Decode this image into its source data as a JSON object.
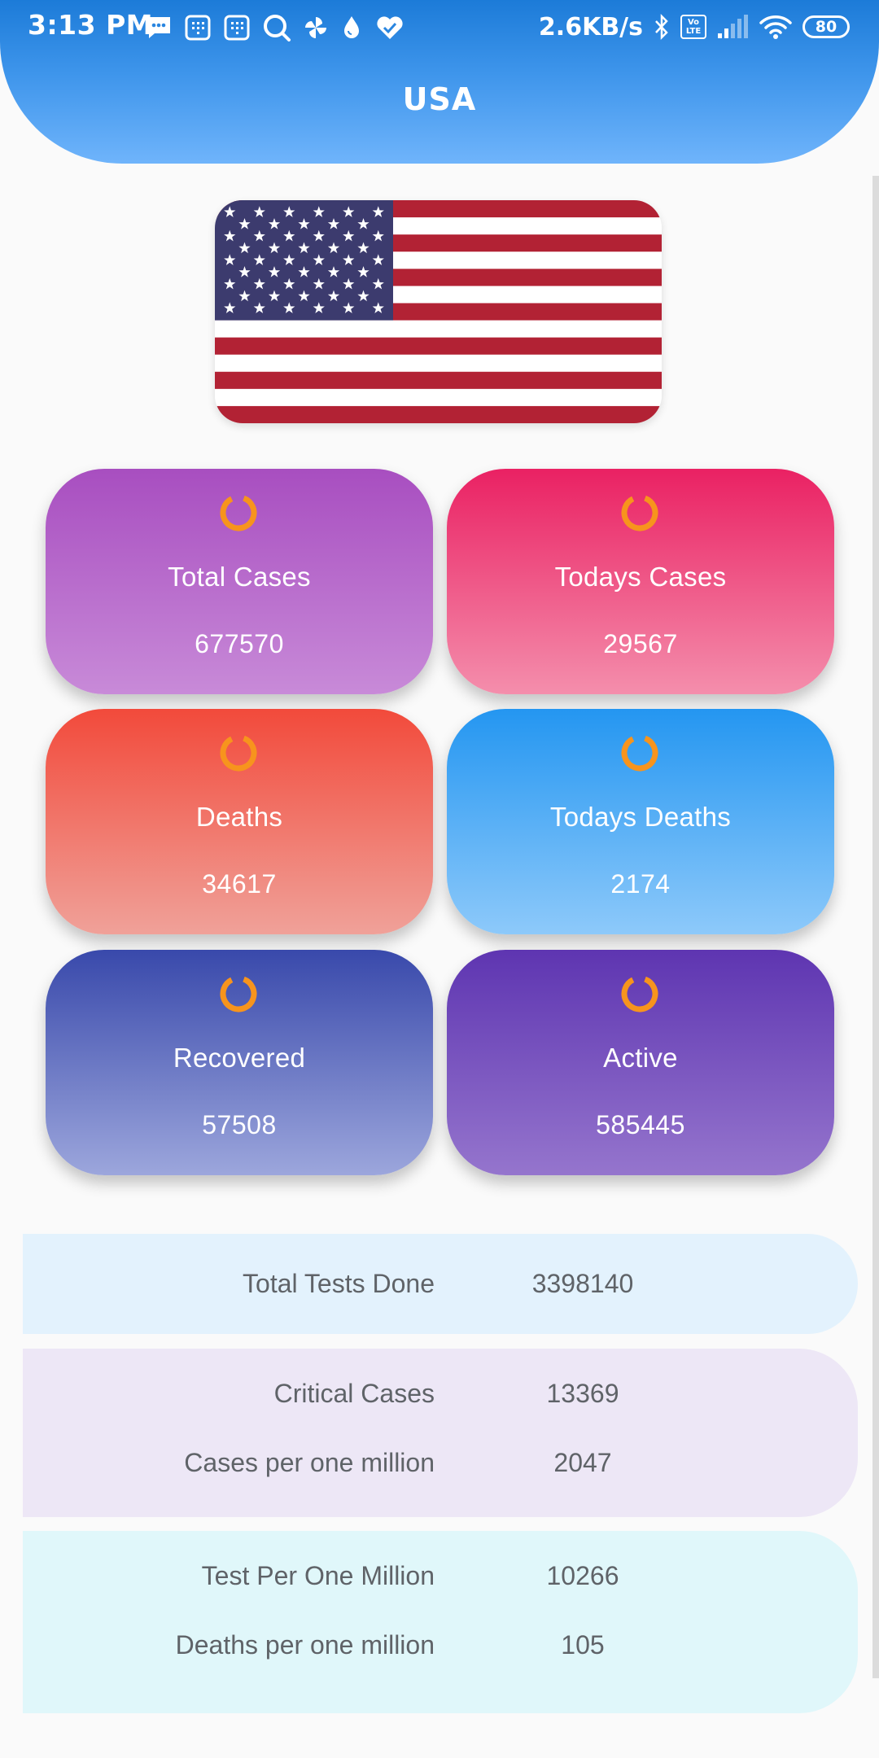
{
  "status_bar": {
    "time": "3:13 PM",
    "network_speed": "2.6KB/s",
    "battery": "80",
    "volte": "Vo LTE",
    "left_icons": [
      "message-icon",
      "sim-dialpad-icon",
      "sim-dialpad-icon-2",
      "search-circle-icon",
      "pinwheel-icon",
      "drop-icon",
      "heart-check-icon"
    ],
    "right_icons": [
      "bluetooth-icon",
      "volte-icon",
      "signal-icon",
      "wifi-icon",
      "battery-icon"
    ]
  },
  "header": {
    "title": "USA"
  },
  "flag": {
    "name": "us-flag",
    "colors": {
      "red": "#b22234",
      "white": "#ffffff",
      "blue": "#3c3b6e"
    }
  },
  "cards": {
    "total_cases": {
      "label": "Total Cases",
      "value": "677570"
    },
    "todays_cases": {
      "label": "Todays Cases",
      "value": "29567"
    },
    "deaths": {
      "label": "Deaths",
      "value": "34617"
    },
    "todays_deaths": {
      "label": "Todays Deaths",
      "value": "2174"
    },
    "recovered": {
      "label": "Recovered",
      "value": "57508"
    },
    "active": {
      "label": "Active",
      "value": "585445"
    }
  },
  "spinner_color": "#f7941d",
  "stats": {
    "total_tests": {
      "label": "Total Tests Done",
      "value": "3398140"
    },
    "critical": {
      "label": "Critical Cases",
      "value": "13369"
    },
    "cases_per_million": {
      "label": "Cases per one million",
      "value": "2047"
    },
    "tests_per_million": {
      "label": "Test Per One Million",
      "value": "10266"
    },
    "deaths_per_million": {
      "label": "Deaths per one million",
      "value": "105"
    }
  }
}
